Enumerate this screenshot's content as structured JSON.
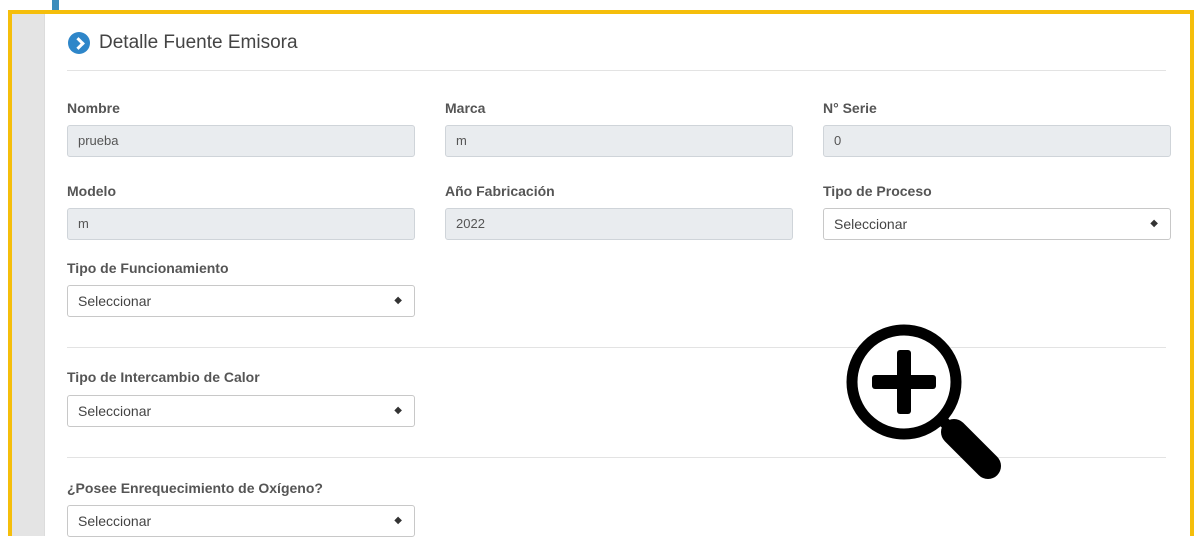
{
  "panel": {
    "title": "Detalle Fuente Emisora"
  },
  "fields": {
    "nombre": {
      "label": "Nombre",
      "value": "prueba"
    },
    "marca": {
      "label": "Marca",
      "value": "m"
    },
    "serie": {
      "label": "N° Serie",
      "value": "0"
    },
    "modelo": {
      "label": "Modelo",
      "value": "m"
    },
    "anio": {
      "label": "Año Fabricación",
      "value": "2022"
    },
    "tipo_proceso": {
      "label": "Tipo de Proceso",
      "value": "Seleccionar"
    },
    "tipo_funcionamiento": {
      "label": "Tipo de Funcionamiento",
      "value": "Seleccionar"
    },
    "tipo_intercambio": {
      "label": "Tipo de Intercambio de Calor",
      "value": "Seleccionar"
    },
    "oxigeno": {
      "label": "¿Posee Enrequecimiento de Oxígeno?",
      "value": "Seleccionar"
    }
  },
  "select_arrow": "◆",
  "colors": {
    "highlight_border": "#f5be0b",
    "accent": "#2e86c9"
  },
  "icons": {
    "title": "chevron-right-circle-icon",
    "overlay": "zoom-in-icon"
  }
}
